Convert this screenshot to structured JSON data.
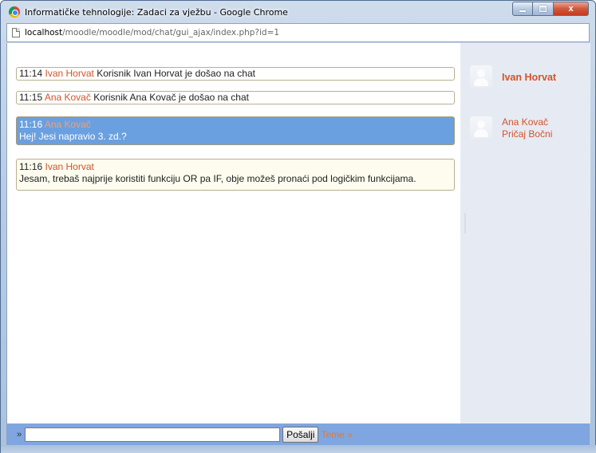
{
  "window": {
    "title": "Informatičke tehnologije: Zadaci za vježbu - Google Chrome",
    "close_label": "x"
  },
  "address": {
    "host": "localhost",
    "path": "/moodle/moodle/mod/chat/gui_ajax/index.php?id=1"
  },
  "messages": [
    {
      "time": "11:14",
      "name": "Ivan Horvat",
      "text": "Korisnik Ivan Horvat je došao na chat"
    },
    {
      "time": "11:15",
      "name": "Ana Kovač",
      "text": "Korisnik Ana Kovač je došao na chat"
    },
    {
      "time": "11:16",
      "name": "Ana Kovač",
      "text": "Hej! Jesi napravio 3. zd.?"
    },
    {
      "time": "11:16",
      "name": "Ivan Horvat",
      "text": "Jesam, trebaš najprije koristiti funkciju OR pa IF, obje možeš pronaći pod logičkim funkcijama."
    }
  ],
  "users": [
    {
      "name": "Ivan Horvat"
    },
    {
      "name": "Ana Kovač",
      "action": "Pričaj Bočni"
    }
  ],
  "input": {
    "prompt": "»",
    "value": "",
    "send_label": "Pošalji",
    "themes_label": "Teme »"
  }
}
